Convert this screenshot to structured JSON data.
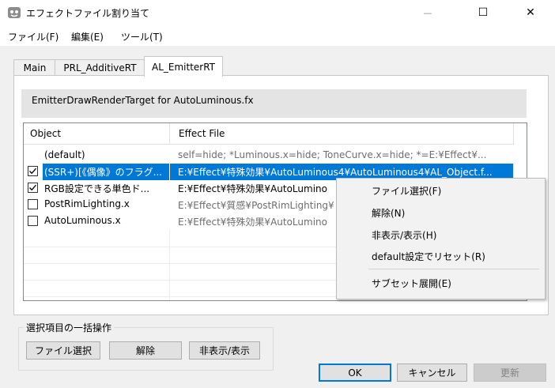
{
  "window": {
    "title": "エフェクトファイル割り当て",
    "controls": {
      "minimize": "—",
      "maximize": "☐",
      "close": "✕"
    }
  },
  "menu": [
    "ファイル(F)",
    "編集(E)",
    "ツール(T)"
  ],
  "tabs": [
    {
      "label": "Main",
      "active": false
    },
    {
      "label": "PRL_AdditiveRT",
      "active": false
    },
    {
      "label": "AL_EmitterRT",
      "active": true
    }
  ],
  "description": "EmitterDrawRenderTarget for AutoLuminous.fx",
  "list": {
    "headers": {
      "object": "Object",
      "effect_file": "Effect File"
    },
    "rows": [
      {
        "checkbox": false,
        "has_checkbox": false,
        "object": "(default)",
        "effect": "self=hide; *Luminous.x=hide; ToneCurve.x=hide; *=E:¥Effect¥...",
        "selected": false,
        "dim": true
      },
      {
        "checkbox": true,
        "has_checkbox": true,
        "object": "(SSR+)[《偶像》のフラグ...",
        "effect": "E:¥Effect¥特殊効果¥AutoLuminous4¥AutoLuminous4¥AL_Object.f...",
        "selected": true,
        "dim": false
      },
      {
        "checkbox": true,
        "has_checkbox": true,
        "object": "RGB設定できる単色ド...",
        "effect": "E:¥Effect¥特殊効果¥AutoLumino",
        "selected": false,
        "dim": false
      },
      {
        "checkbox": false,
        "has_checkbox": true,
        "object": "PostRimLighting.x",
        "effect": "E:¥Effect¥質感¥PostRimLighting¥",
        "selected": false,
        "dim": true
      },
      {
        "checkbox": false,
        "has_checkbox": true,
        "object": "AutoLuminous.x",
        "effect": "E:¥Effect¥特殊効果¥AutoLumino",
        "selected": false,
        "dim": true
      }
    ]
  },
  "context_menu": {
    "items": [
      "ファイル選択(F)",
      "解除(N)",
      "非表示/表示(H)",
      "default設定でリセット(R)",
      "サブセット展開(E)"
    ]
  },
  "bulk": {
    "title": "選択項目の一括操作",
    "buttons": [
      "ファイル選択",
      "解除",
      "非表示/表示"
    ]
  },
  "footer": {
    "ok": "OK",
    "cancel": "キャンセル",
    "update": "更新"
  },
  "colors": {
    "selection": "#0078d7",
    "dim_text": "#6d6d6d"
  }
}
